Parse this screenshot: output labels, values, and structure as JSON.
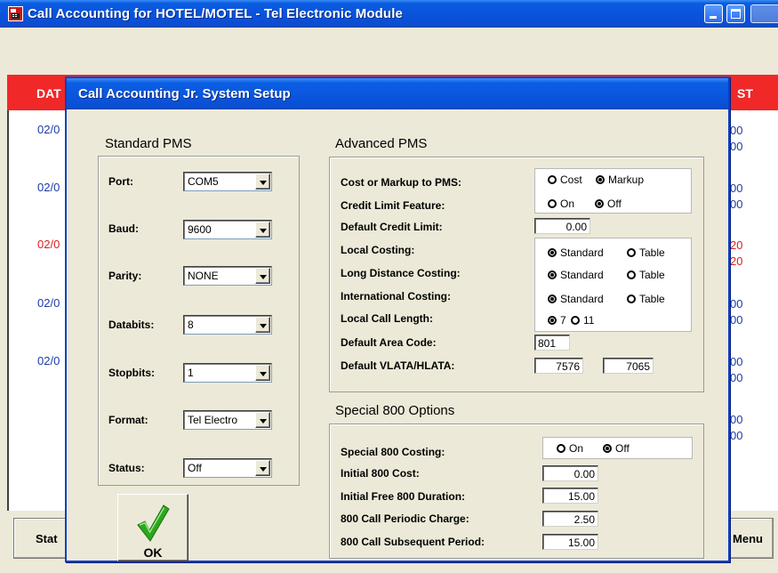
{
  "main_window": {
    "title": "Call Accounting for HOTEL/MOTEL - Tel Electronic Module",
    "header": {
      "left": "DAT",
      "right": "ST"
    },
    "rows_left": [
      "02/0",
      "02/0",
      "02/0",
      "02/0",
      "02/0"
    ],
    "rows_right": [
      "00",
      "00",
      "00",
      "00",
      "20",
      "20",
      "00",
      "00",
      "00",
      "00",
      "00",
      "00"
    ],
    "status_button": "Stat",
    "menu_button": "Menu"
  },
  "dialog": {
    "title": "Call Accounting Jr. System Setup",
    "standard_pms": {
      "title": "Standard PMS",
      "fields": [
        {
          "label": "Port:",
          "value": "COM5"
        },
        {
          "label": "Baud:",
          "value": "9600"
        },
        {
          "label": "Parity:",
          "value": "NONE"
        },
        {
          "label": "Databits:",
          "value": "8"
        },
        {
          "label": "Stopbits:",
          "value": "1"
        },
        {
          "label": "Format:",
          "value": "Tel Electro"
        },
        {
          "label": "Status:",
          "value": "Off"
        }
      ]
    },
    "advanced_pms": {
      "title": "Advanced PMS",
      "cost_or_markup": {
        "label": "Cost or Markup to PMS:",
        "options": [
          "Cost",
          "Markup"
        ],
        "selected": "Markup"
      },
      "credit_limit_feature": {
        "label": "Credit Limit Feature:",
        "options": [
          "On",
          "Off"
        ],
        "selected": "Off"
      },
      "default_credit_limit": {
        "label": "Default Credit Limit:",
        "value": "0.00"
      },
      "local_costing": {
        "label": "Local Costing:",
        "options": [
          "Standard",
          "Table"
        ],
        "selected": "Standard"
      },
      "long_distance_costing": {
        "label": "Long Distance Costing:",
        "options": [
          "Standard",
          "Table"
        ],
        "selected": "Standard"
      },
      "international_costing": {
        "label": "International Costing:",
        "options": [
          "Standard",
          "Table"
        ],
        "selected": "Standard"
      },
      "local_call_length": {
        "label": "Local Call Length:",
        "options": [
          "7",
          "11"
        ],
        "selected": "7"
      },
      "default_area_code": {
        "label": "Default Area Code:",
        "value": "801"
      },
      "default_vlata_hlata": {
        "label": "Default VLATA/HLATA:",
        "vlata": "7576",
        "hlata": "7065"
      }
    },
    "special_800": {
      "title": "Special 800 Options",
      "costing": {
        "label": "Special 800 Costing:",
        "options": [
          "On",
          "Off"
        ],
        "selected": "Off"
      },
      "initial_cost": {
        "label": "Initial 800 Cost:",
        "value": "0.00"
      },
      "initial_free_duration": {
        "label": "Initial Free 800 Duration:",
        "value": "15.00"
      },
      "periodic_charge": {
        "label": "800 Call Periodic Charge:",
        "value": "2.50"
      },
      "subsequent_period": {
        "label": "800 Call Subsequent Period:",
        "value": "15.00"
      }
    },
    "ok_button": "OK"
  },
  "colors": {
    "titlebar": "#0a56de",
    "header_red": "#f02828",
    "row_blue": "#1c3aa8",
    "row_red": "#d92020",
    "check_green": "#2ca81c"
  }
}
